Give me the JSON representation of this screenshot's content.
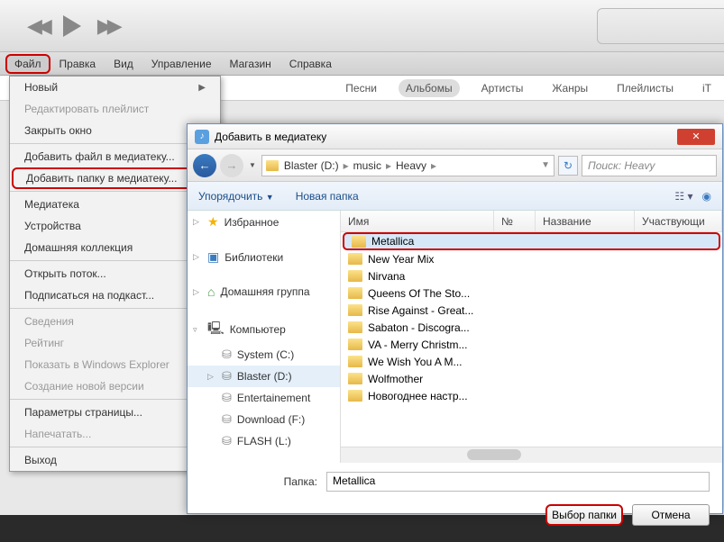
{
  "menu": {
    "file": "Файл",
    "edit": "Правка",
    "view": "Вид",
    "manage": "Управление",
    "store": "Магазин",
    "help": "Справка"
  },
  "tabs": {
    "songs": "Песни",
    "albums": "Альбомы",
    "artists": "Артисты",
    "genres": "Жанры",
    "playlists": "Плейлисты",
    "it": "iT"
  },
  "dd": {
    "new": "Новый",
    "editpl": "Редактировать плейлист",
    "closewin": "Закрыть окно",
    "addfile": "Добавить файл в медиатеку...",
    "addfolder": "Добавить папку в медиатеку...",
    "library": "Медиатека",
    "devices": "Устройства",
    "homeshare": "Домашняя коллекция",
    "openstream": "Открыть поток...",
    "subscribe": "Подписаться на подкаст...",
    "info": "Сведения",
    "rating": "Рейтинг",
    "showexpl": "Показать в Windows Explorer",
    "newver": "Создание новой версии",
    "pagesetup": "Параметры страницы...",
    "print": "Напечатать...",
    "exit": "Выход"
  },
  "dialog": {
    "title": "Добавить в медиатеку",
    "crumb1": "Blaster (D:)",
    "crumb2": "music",
    "crumb3": "Heavy",
    "search_ph": "Поиск: Heavy",
    "organize": "Упорядочить",
    "newfolder": "Новая папка",
    "col_name": "Имя",
    "col_num": "№",
    "col_title": "Название",
    "col_part": "Участвующи",
    "nav": {
      "fav": "Избранное",
      "libs": "Библиотеки",
      "hg": "Домашняя группа",
      "comp": "Компьютер",
      "sys": "System (C:)",
      "blaster": "Blaster (D:)",
      "ent": "Entertainement",
      "dl": "Download (F:)",
      "flash": "FLASH (L:)"
    },
    "rows": [
      "Metallica",
      "New Year Mix",
      "Nirvana",
      "Queens Of The Sto...",
      "Rise Against - Great...",
      "Sabaton - Discogra...",
      "VA - Merry Christm...",
      "We Wish You A M...",
      "Wolfmother",
      "Новогоднее настр..."
    ],
    "folder_lbl": "Папка:",
    "folder_val": "Metallica",
    "btn_choose": "Выбор папки",
    "btn_cancel": "Отмена"
  }
}
